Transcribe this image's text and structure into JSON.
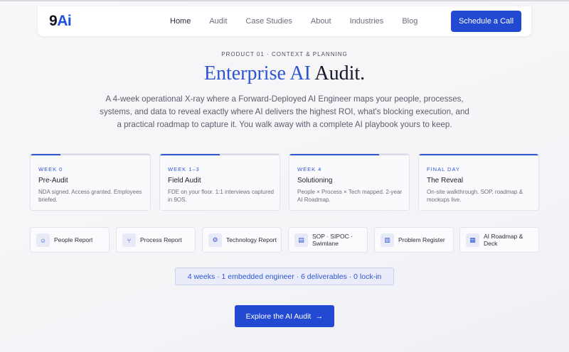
{
  "nav": {
    "logo_left": "9",
    "logo_right": "Ai",
    "links": [
      "Home",
      "Audit",
      "Case Studies",
      "About",
      "Industries",
      "Blog"
    ],
    "active": "Home",
    "cta": "Schedule a Call"
  },
  "hero": {
    "eyebrow": "PRODUCT 01 · CONTEXT & PLANNING",
    "title_accent": "Enterprise AI",
    "title_rest": "Audit.",
    "description": "A 4-week operational X-ray where a Forward-Deployed AI Engineer maps your people, processes, systems, and data to reveal exactly where AI delivers the highest ROI, what's blocking execution, and a practical roadmap to capture it. You walk away with a complete AI playbook yours to keep."
  },
  "weeks": [
    {
      "week": "WEEK 0",
      "title": "Pre-Audit",
      "desc": "NDA signed. Access granted. Employees briefed.",
      "progress": 0.25
    },
    {
      "week": "WEEK 1–3",
      "title": "Field Audit",
      "desc": "FDE on your floor. 1:1 interviews captured in 9OS.",
      "progress": 0.5
    },
    {
      "week": "WEEK 4",
      "title": "Solutioning",
      "desc": "People × Process × Tech mapped. 2-year AI Roadmap.",
      "progress": 0.75
    },
    {
      "week": "FINAL DAY",
      "title": "The Reveal",
      "desc": "On-site walkthrough. SOP, roadmap & mockups live.",
      "progress": 1.0
    }
  ],
  "deliverables": [
    {
      "label": "People Report",
      "icon": "people-icon",
      "glyph": "☺"
    },
    {
      "label": "Process Report",
      "icon": "process-icon",
      "glyph": "⑂"
    },
    {
      "label": "Technology Report",
      "icon": "gear-icon",
      "glyph": "⚙"
    },
    {
      "label": "SOP · SIPOC · Swimlane",
      "icon": "document-icon",
      "glyph": "▤"
    },
    {
      "label": "Problem Register",
      "icon": "clipboard-icon",
      "glyph": "▥"
    },
    {
      "label": "AI Roadmap & Deck",
      "icon": "map-icon",
      "glyph": "▦"
    }
  ],
  "summary_pill": "4 weeks · 1 embedded engineer · 6 deliverables · 0 lock-in",
  "cta_main": "Explore the AI Audit",
  "colors": {
    "accent": "#2d55d0",
    "button": "#2249d1"
  }
}
